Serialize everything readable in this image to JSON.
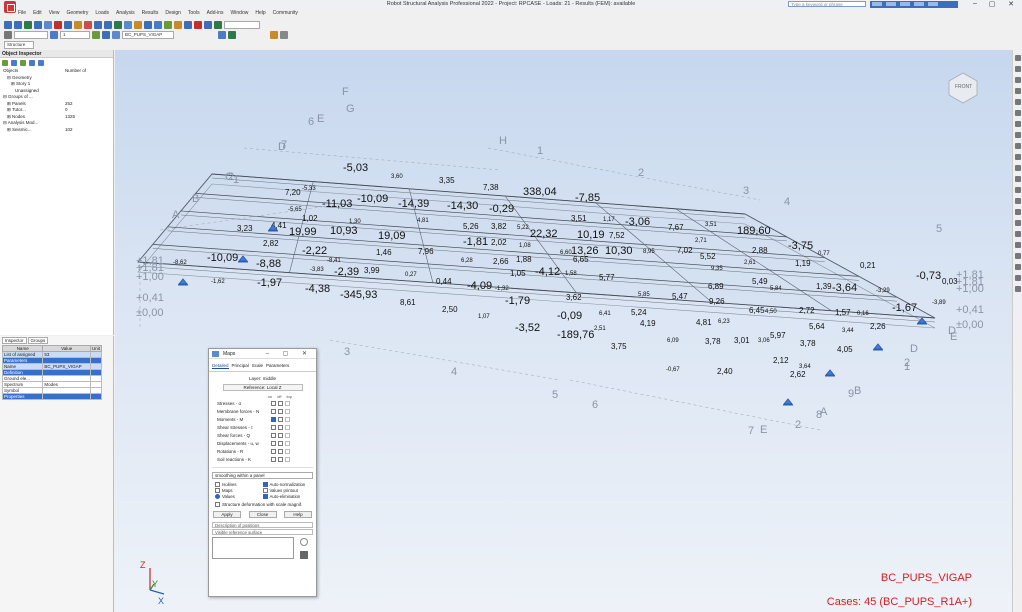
{
  "window": {
    "title": "Robot Structural Analysis Professional 2022 - Project: RPCASE - Loads: 21 - Results (FEM): available",
    "search_placeholder": "Type a keyword or phrase",
    "minimize": "–",
    "maximize": "▢",
    "close": "✕"
  },
  "menu": [
    "File",
    "Edit",
    "View",
    "Geometry",
    "Loads",
    "Analysis",
    "Results",
    "Design",
    "Tools",
    "Add-ins",
    "Window",
    "Help",
    "Community"
  ],
  "toolbar": {
    "select1": "",
    "select2": "1",
    "select3": "BC_PUPS_VIGAP",
    "select4": "Structure",
    "zoom": "45"
  },
  "inspector": {
    "title": "Object Inspector",
    "tree": [
      {
        "name": "Objects",
        "value": "Number of",
        "indent": 0
      },
      {
        "name": "⊟ Geometry",
        "value": "",
        "indent": 1
      },
      {
        "name": "⊞ Story 1",
        "value": "",
        "indent": 2
      },
      {
        "name": "Unassigned",
        "value": "",
        "indent": 3
      },
      {
        "name": "⊟ Groups of ...",
        "value": "",
        "indent": 0
      },
      {
        "name": "⊞ Panels",
        "value": "252",
        "indent": 1
      },
      {
        "name": "⊞ Tutor...",
        "value": "0",
        "indent": 1
      },
      {
        "name": "⊞ Nodes",
        "value": "1325",
        "indent": 1
      },
      {
        "name": "⊟ Analysis Mod...",
        "value": "",
        "indent": 0
      },
      {
        "name": "⊞ Seismic...",
        "value": "102",
        "indent": 1
      }
    ]
  },
  "properties": {
    "tabs": [
      "Inspector",
      "Groups"
    ],
    "headers": [
      "Name",
      "Value",
      "Unit"
    ],
    "rows": [
      {
        "name": "List of assigned",
        "value": "53",
        "unit": "",
        "type": "hl"
      },
      {
        "name": "Parameters",
        "value": "",
        "unit": "",
        "type": "sec"
      },
      {
        "name": "Name",
        "value": "BC_PUPS_VIGAP",
        "unit": "",
        "type": "hl"
      },
      {
        "name": "Definition",
        "value": "",
        "unit": "",
        "type": "sec"
      },
      {
        "name": "Ground ele...",
        "value": "",
        "unit": "",
        "type": ""
      },
      {
        "name": "Spectrum",
        "value": "Modes",
        "unit": "",
        "type": ""
      },
      {
        "name": "Symbol",
        "value": "",
        "unit": "",
        "type": ""
      },
      {
        "name": "Properties",
        "value": "",
        "unit": "",
        "type": "sec"
      }
    ]
  },
  "dialog": {
    "title": "Maps",
    "tabs": [
      "Detailed",
      "Principal",
      "Scale",
      "Parameters"
    ],
    "layer_label": "Layer: middle",
    "current_button": "Reference: Local Z",
    "col_headers": [
      "on",
      "off",
      "top"
    ],
    "rows": [
      {
        "label": "Stresses - σ",
        "checks": [
          false,
          false,
          false
        ]
      },
      {
        "label": "Membrane forces - N",
        "checks": [
          false,
          false,
          false
        ]
      },
      {
        "label": "Moments - M",
        "checks": [
          true,
          false,
          false
        ]
      },
      {
        "label": "Shear stresses - τ",
        "checks": [
          false,
          false,
          false
        ]
      },
      {
        "label": "Shear forces - Q",
        "checks": [
          false,
          false,
          false
        ]
      },
      {
        "label": "Displacements - u, w",
        "checks": [
          false,
          false,
          false
        ]
      },
      {
        "label": "Rotations - R",
        "checks": [
          false,
          false,
          false
        ]
      },
      {
        "label": "Soil reactions - K",
        "checks": [
          false,
          false,
          false
        ]
      }
    ],
    "smoothing_label": "smoothing within a panel",
    "options": [
      {
        "label": "Isolines",
        "kind": "check",
        "on": false
      },
      {
        "label": "Auto-normalization",
        "kind": "check",
        "on": true
      },
      {
        "label": "Maps",
        "kind": "check",
        "on": false
      },
      {
        "label": "Values printout",
        "kind": "check",
        "on": false
      },
      {
        "label": "Values",
        "kind": "radio",
        "on": true
      },
      {
        "label": "Auto-elimination",
        "kind": "check",
        "on": true
      }
    ],
    "deform_label": "Structure deformation with scale magnif.",
    "buttons": [
      "Apply",
      "Close",
      "Help"
    ],
    "desc_label": "Description of positions",
    "field_label": "Visible reference surface"
  },
  "viewport": {
    "case_name": "BC_PUPS_VIGAP",
    "case_info": "Cases: 45 (BC_PUPS_R1A+)",
    "axes": {
      "z": "Z",
      "y": "Y",
      "x": "X"
    },
    "accent": "#d42020"
  },
  "values": [
    "-5,03",
    "3,60",
    "3,35",
    "7,38",
    "338,04",
    "-7,85",
    "7,20",
    "-5,33",
    "-11,03",
    "-10,09",
    "-14,39",
    "-14,30",
    "-0,29",
    "-5,65",
    "3,23",
    "4,41",
    "19,99",
    "10,93",
    "19,09",
    "4,81",
    "5,26",
    "3,82",
    "5,22",
    "22,32",
    "3,51",
    "1,17",
    "-3,06",
    "7,67",
    "3,51",
    "189,60",
    "1,02",
    "1,30",
    "-1,81",
    "2,02",
    "1,08",
    "10,19",
    "7,52",
    "2,71",
    "2,88",
    "-3,75",
    "0,77",
    "2,82",
    "-2,22",
    "-8,41",
    "1,46",
    "7,96",
    "6,28",
    "2,66",
    "1,88",
    "6,60",
    "13,26",
    "10,30",
    "8,95",
    "7,02",
    "5,52",
    "2,61",
    "1,19",
    "0,21",
    "-8,62",
    "-10,09",
    "-8,88",
    "-3,83",
    "-2,39",
    "3,99",
    "0,27",
    "0,44",
    "-4,09",
    "-1,32",
    "1,05",
    "-4,12",
    "1,58",
    "5,77",
    "6,65",
    "9,35",
    "6,89",
    "5,49",
    "5,84",
    "1,39",
    "-3,64",
    "-3,29",
    "-0,73",
    "0,03",
    "-1,62",
    "-1,97",
    "-4,38",
    "-345,93",
    "8,61",
    "2,50",
    "1,07",
    "-1,79",
    "3,62",
    "5,85",
    "5,47",
    "9,26",
    "-3,89",
    "-3,52",
    "-0,09",
    "6,41",
    "5,24",
    "6,45",
    "4,50",
    "2,72",
    "1,57",
    "0,16",
    "-1,67",
    "-189,76",
    "2,51",
    "4,19",
    "4,81",
    "6,23",
    "5,97",
    "5,64",
    "3,44",
    "2,26",
    "3,75",
    "6,09",
    "3,78",
    "3,01",
    "3,06",
    "3,78",
    "4,05",
    "-0,67",
    "2,40",
    "2,12",
    "3,64",
    "2,62"
  ],
  "axis_labels": [
    "A",
    "B",
    "C",
    "D",
    "E",
    "F",
    "G",
    "H",
    "1",
    "2",
    "3",
    "4",
    "5",
    "6",
    "7",
    "1",
    "2",
    "3",
    "4",
    "5",
    "6",
    "7",
    "8",
    "9",
    "2",
    "D",
    "E",
    "E",
    "2",
    "A",
    "B",
    "1",
    "D"
  ],
  "levels": [
    "+1,81",
    "+1,81",
    "+1,00",
    "+0,41",
    "±0,00"
  ],
  "levels_right": [
    "+1,81",
    "+1,81",
    "+1,00",
    "+0,41",
    "±0,00"
  ]
}
